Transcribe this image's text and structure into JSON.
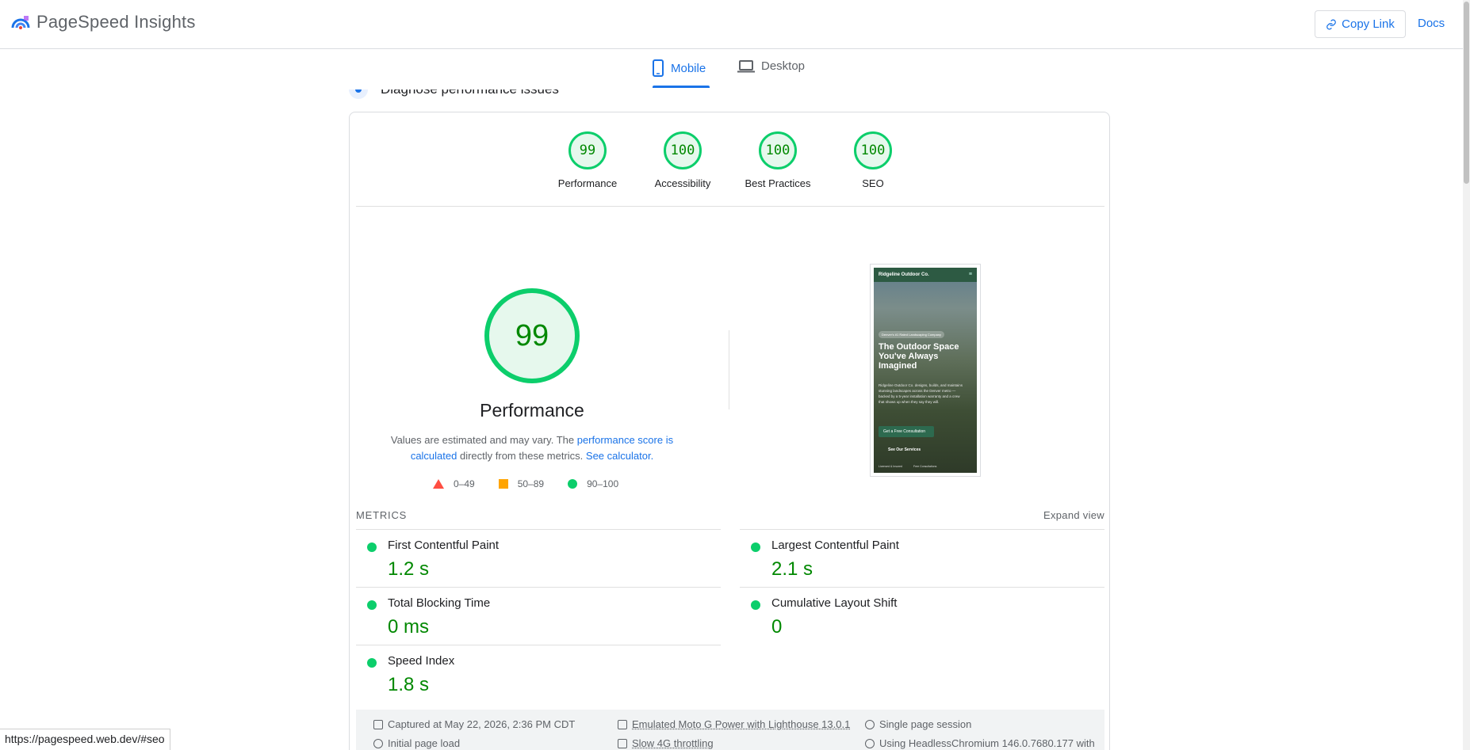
{
  "header": {
    "app_title": "PageSpeed Insights",
    "copy_link_label": "Copy Link",
    "docs_label": "Docs"
  },
  "tabs": [
    {
      "label": "Mobile",
      "active": true,
      "icon": "smartphone-icon"
    },
    {
      "label": "Desktop",
      "active": false,
      "icon": "laptop-icon"
    }
  ],
  "section": {
    "diagnose_title": "Diagnose performance issues"
  },
  "scores": [
    {
      "value": "99",
      "label": "Performance"
    },
    {
      "value": "100",
      "label": "Accessibility"
    },
    {
      "value": "100",
      "label": "Best Practices"
    },
    {
      "value": "100",
      "label": "SEO"
    }
  ],
  "performance": {
    "score": "99",
    "title": "Performance",
    "desc_prefix": "Values are estimated and may vary. The ",
    "desc_link1": "performance score is calculated",
    "desc_mid": " directly from these metrics. ",
    "desc_link2": "See calculator.",
    "legend": [
      {
        "range": "0–49",
        "shape": "triangle",
        "color": "#ff4e42"
      },
      {
        "range": "50–89",
        "shape": "square",
        "color": "#ffa400"
      },
      {
        "range": "90–100",
        "shape": "circle",
        "color": "#0cce6b"
      }
    ]
  },
  "screenshot": {
    "site_name": "Ridgeline Outdoor Co.",
    "pill": "Denver's #1 Rated Landscaping Company",
    "headline": "The Outdoor Space You've Always Imagined",
    "body": "Ridgeline Outdoor Co. designs, builds, and maintains stunning landscapes across the Denver metro — backed by a 5-year installation warranty and a crew that shows up when they say they will.",
    "cta_primary": "Get a Free Consultation",
    "cta_secondary": "See Our Services",
    "foot_left": "Licensed & Insured",
    "foot_right": "Free Consultations"
  },
  "metrics": {
    "heading": "METRICS",
    "expand_label": "Expand view",
    "items": [
      {
        "name": "First Contentful Paint",
        "value": "1.2 s"
      },
      {
        "name": "Largest Contentful Paint",
        "value": "2.1 s"
      },
      {
        "name": "Total Blocking Time",
        "value": "0 ms"
      },
      {
        "name": "Cumulative Layout Shift",
        "value": "0"
      },
      {
        "name": "Speed Index",
        "value": "1.8 s"
      }
    ]
  },
  "run_info": {
    "captured": "Captured at May 22, 2026, 2:36 PM CDT",
    "device": "Emulated Moto G Power with Lighthouse 13.0.1",
    "session": "Single page session",
    "load": "Initial page load",
    "throttling": "Slow 4G throttling",
    "browser": "Using HeadlessChromium 146.0.7680.177 with"
  },
  "status_url": "https://pagespeed.web.dev/#seo",
  "colors": {
    "accent": "#1a73e8",
    "pass": "#0cce6b",
    "pass_text": "#008800",
    "average": "#ffa400",
    "fail": "#ff4e42"
  }
}
